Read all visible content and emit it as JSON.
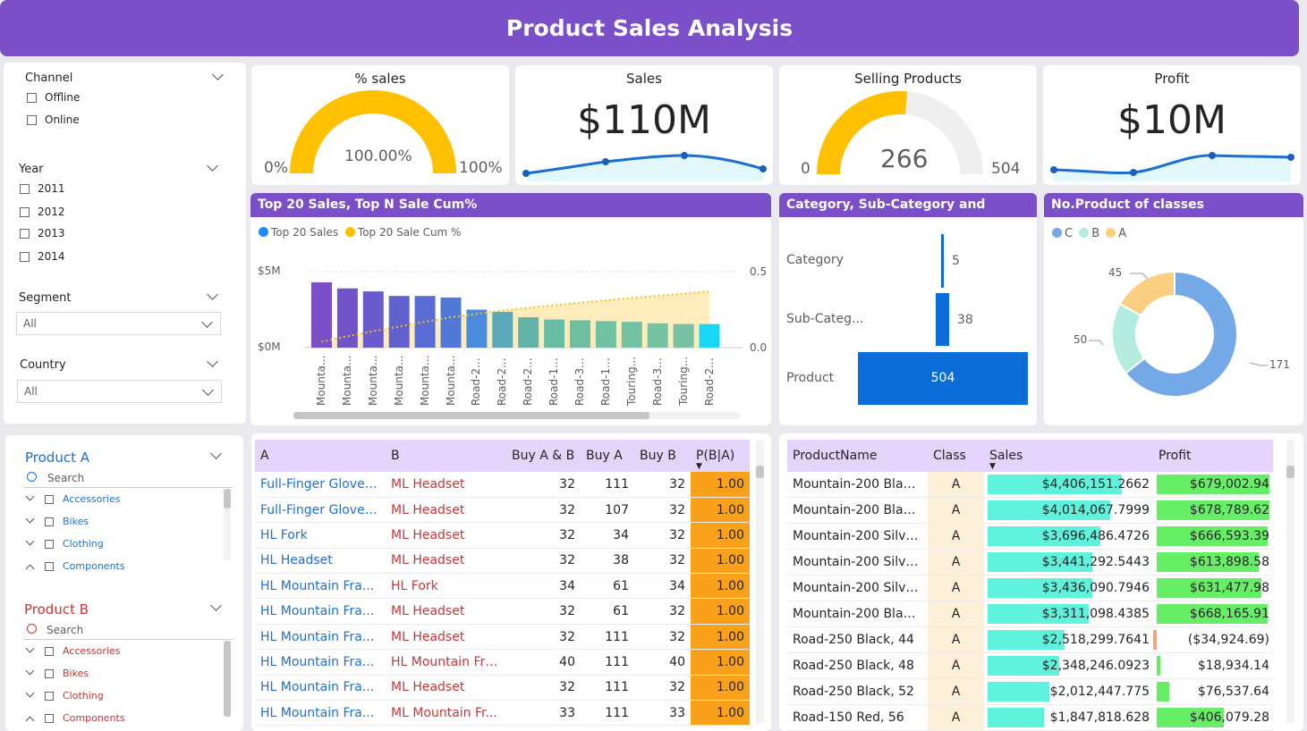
{
  "header": {
    "title": "Product Sales Analysis"
  },
  "slicers": {
    "channel": {
      "label": "Channel",
      "options": [
        "Offline",
        "Online"
      ]
    },
    "year": {
      "label": "Year",
      "options": [
        "2011",
        "2012",
        "2013",
        "2014"
      ]
    },
    "segment": {
      "label": "Segment",
      "value": "All"
    },
    "country": {
      "label": "Country",
      "value": "All"
    }
  },
  "kpis": {
    "pct_sales": {
      "title": "% sales",
      "value": "100.00%",
      "min": "0%",
      "max": "100%",
      "fraction": 1.0
    },
    "sales": {
      "title": "Sales",
      "value": "$110M"
    },
    "selling_products": {
      "title": "Selling Products",
      "value": "266",
      "min": "0",
      "max": "504",
      "fraction": 0.528
    },
    "profit": {
      "title": "Profit",
      "value": "$10M"
    }
  },
  "top20": {
    "title": "Top 20 Sales, Top N Sale Cum%",
    "legend": [
      "Top 20 Sales",
      "Top 20 Sale Cum %"
    ],
    "y_left": [
      "$5M",
      "$0M"
    ],
    "y_right": [
      "0.5",
      "0.0"
    ],
    "x_labels": [
      "Mounta...",
      "Mounta...",
      "Mounta...",
      "Mounta...",
      "Mounta...",
      "Mounta...",
      "Road-2...",
      "Road-2...",
      "Road-2...",
      "Road-1...",
      "Road-3...",
      "Road-1...",
      "Touring...",
      "Road-3...",
      "Touring...",
      "Road-2..."
    ]
  },
  "category": {
    "title": "Category, Sub-Category and Product",
    "labels": [
      "Category",
      "Sub-Categ...",
      "Product"
    ],
    "values": [
      "5",
      "38",
      "504"
    ]
  },
  "classes": {
    "title": "No.Product of classes",
    "legend": [
      "C",
      "B",
      "A"
    ],
    "values": {
      "C": "171",
      "B": "50",
      "A": "45"
    }
  },
  "product_a": {
    "label": "Product A",
    "search": "Search",
    "items": [
      "Accessories",
      "Bikes",
      "Clothing",
      "Components"
    ]
  },
  "product_b": {
    "label": "Product B",
    "search": "Search",
    "items": [
      "Accessories",
      "Bikes",
      "Clothing",
      "Components"
    ]
  },
  "assoc_table": {
    "headers": [
      "A",
      "B",
      "Buy A & B",
      "Buy A",
      "Buy B",
      "P(B|A)"
    ],
    "rows": [
      [
        "Full-Finger Gloves...",
        "ML Headset",
        "32",
        "111",
        "32",
        "1.00"
      ],
      [
        "Full-Finger Gloves...",
        "ML Headset",
        "32",
        "107",
        "32",
        "1.00"
      ],
      [
        "HL Fork",
        "ML Headset",
        "32",
        "34",
        "32",
        "1.00"
      ],
      [
        "HL Headset",
        "ML Headset",
        "32",
        "38",
        "32",
        "1.00"
      ],
      [
        "HL Mountain Fra...",
        "HL Fork",
        "34",
        "61",
        "34",
        "1.00"
      ],
      [
        "HL Mountain Fra...",
        "ML Headset",
        "32",
        "61",
        "32",
        "1.00"
      ],
      [
        "HL Mountain Fra...",
        "ML Headset",
        "32",
        "111",
        "32",
        "1.00"
      ],
      [
        "HL Mountain Fra...",
        "HL Mountain Fra...",
        "40",
        "111",
        "40",
        "1.00"
      ],
      [
        "HL Mountain Fra...",
        "ML Headset",
        "32",
        "111",
        "32",
        "1.00"
      ],
      [
        "HL Mountain Fra...",
        "ML Mountain Fr...",
        "33",
        "111",
        "33",
        "1.00"
      ]
    ]
  },
  "product_table": {
    "headers": [
      "ProductName",
      "Class",
      "Sales",
      "Profit"
    ],
    "rows": [
      [
        "Mountain-200 Black...",
        "A",
        "$4,406,151.2662",
        "$679,002.94"
      ],
      [
        "Mountain-200 Black...",
        "A",
        "$4,014,067.7999",
        "$678,789.62"
      ],
      [
        "Mountain-200 Silve...",
        "A",
        "$3,696,486.4726",
        "$666,593.39"
      ],
      [
        "Mountain-200 Silve...",
        "A",
        "$3,441,292.5443",
        "$613,898.58"
      ],
      [
        "Mountain-200 Silve...",
        "A",
        "$3,436,090.7946",
        "$631,477.98"
      ],
      [
        "Mountain-200 Black...",
        "A",
        "$3,311,098.4385",
        "$668,165.91"
      ],
      [
        "Road-250 Black, 44",
        "A",
        "$2,518,299.7641",
        "($34,924.69)"
      ],
      [
        "Road-250 Black, 48",
        "A",
        "$2,348,246.0923",
        "$18,934.14"
      ],
      [
        "Road-250 Black, 52",
        "A",
        "$2,012,447.775",
        "$76,537.64"
      ],
      [
        "Road-150 Red, 56",
        "A",
        "$1,847,818.628",
        "$406,079.28"
      ]
    ]
  }
}
